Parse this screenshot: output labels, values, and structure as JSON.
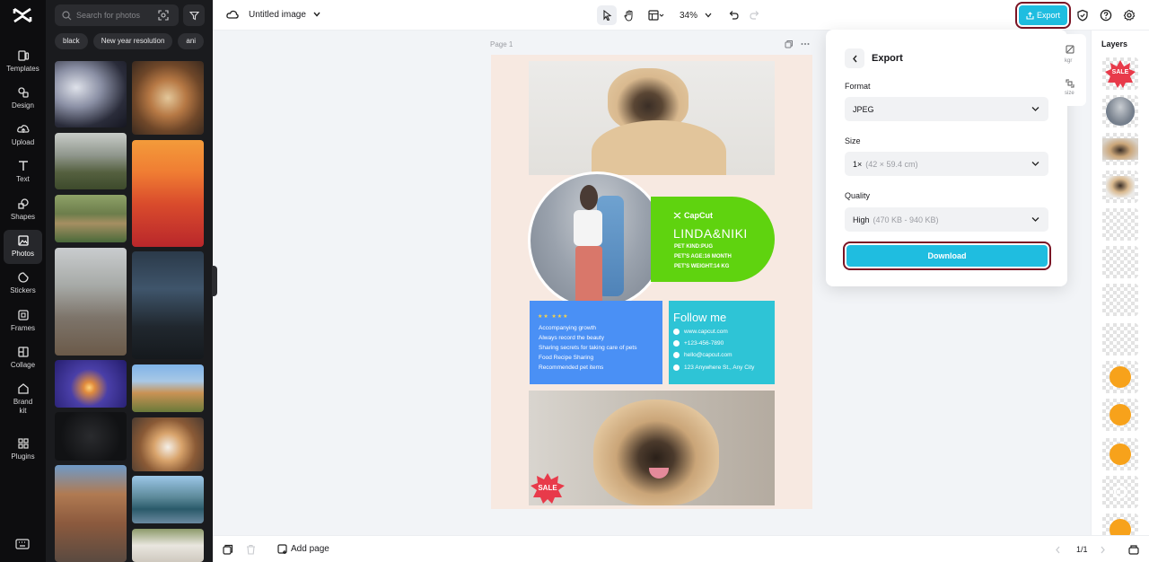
{
  "rail": {
    "items": [
      {
        "label": "Templates",
        "icon": "templates-icon"
      },
      {
        "label": "Design",
        "icon": "design-icon"
      },
      {
        "label": "Upload",
        "icon": "upload-icon"
      },
      {
        "label": "Text",
        "icon": "text-icon"
      },
      {
        "label": "Shapes",
        "icon": "shapes-icon"
      },
      {
        "label": "Photos",
        "icon": "photos-icon",
        "active": true
      },
      {
        "label": "Stickers",
        "icon": "stickers-icon"
      },
      {
        "label": "Frames",
        "icon": "frames-icon"
      },
      {
        "label": "Collage",
        "icon": "collage-icon"
      },
      {
        "label": "Brand\nkit",
        "icon": "brand-kit-icon"
      },
      {
        "label": "Plugins",
        "icon": "plugins-icon"
      }
    ]
  },
  "photos": {
    "search_placeholder": "Search for photos",
    "chips": [
      "black",
      "New year resolution",
      "ani"
    ]
  },
  "topbar": {
    "title": "Untitled image",
    "zoom": "34%",
    "export_label": "Export"
  },
  "canvas": {
    "page_label": "Page 1",
    "brand": "CapCut",
    "names": "LINDA&NIKI",
    "pet_kind": "PET KIND:PUG",
    "pet_age": "PET'S AGE:16 MONTH",
    "pet_weight": "PET'S WEIGHT:14 KG",
    "stars": "★★ ★★★",
    "list": [
      "Accompanying growth",
      "Always record the beauty",
      "Sharing secrets for taking care of pets",
      "Food Recipe Sharing",
      "Recommended pet items"
    ],
    "follow_title": "Follow me",
    "contacts": [
      "www.capcut.com",
      "+123-456-7890",
      "hello@capcut.com",
      "123 Anywhere St., Any City"
    ],
    "sale": "SALE"
  },
  "export_panel": {
    "title": "Export",
    "format_label": "Format",
    "format_value": "JPEG",
    "size_label": "Size",
    "size_value": "1×",
    "size_hint": "(42 × 59.4 cm)",
    "quality_label": "Quality",
    "quality_value": "High",
    "quality_hint": "(470 KB - 940 KB)",
    "download_label": "Download"
  },
  "side_peek": {
    "top": "kgr",
    "bottom": "size"
  },
  "layers": {
    "title": "Layers",
    "sale": "SALE"
  },
  "bottombar": {
    "add_page": "Add page",
    "page_count": "1/1"
  },
  "colors": {
    "accent": "#1fbde0",
    "highlight": "#7a1424",
    "green": "#5fd30f",
    "blue": "#4a90f5",
    "teal": "#2ec4d6"
  }
}
